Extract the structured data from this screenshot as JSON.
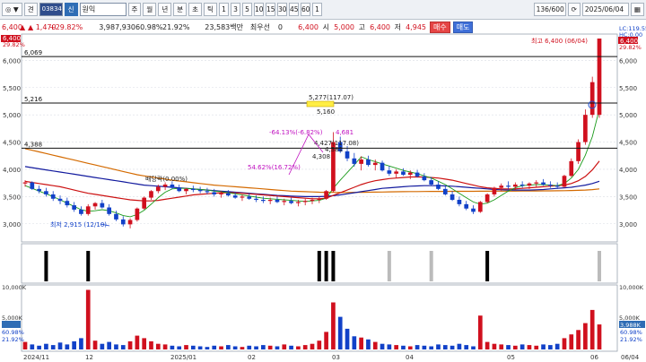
{
  "toolbar": {
    "button_a": "◎ ▼",
    "button_b": "견",
    "code_value": "038340",
    "tag": "신",
    "stock_name": "원익",
    "periods": [
      "주",
      "월",
      "년",
      "분",
      "초",
      "틱"
    ],
    "intervals": [
      "1",
      "3",
      "5",
      "10",
      "15",
      "30",
      "45",
      "60",
      "1"
    ],
    "count_value": "136/600",
    "date_value": "2025/06/04"
  },
  "quote": {
    "price": "6,400",
    "change": "▲ 1,470",
    "change_pct": "+29.82%",
    "volume": "3,987,930",
    "turnover_pct": "60.98%",
    "ratio": "21.92%",
    "amount": "23,583백만",
    "min_label": "최우선",
    "min_value": "0",
    "cur_value": "6,400",
    "open_label": "시",
    "open_value": "5,000",
    "high_label": "고",
    "high_value": "6,400",
    "low_label": "저",
    "low_value": "4,945",
    "buy_label": "매수",
    "sell_label": "매도"
  },
  "colors": {
    "up": "#d0101e",
    "down": "#1141c8",
    "ma5": "#1a9a1a",
    "ma20": "#cc1111",
    "ma60": "#121a9e",
    "ma120": "#d46a00"
  },
  "price_axis": {
    "ticks": [
      "6,000",
      "5,500",
      "5,000",
      "4,500",
      "4,000",
      "3,500",
      "3,000"
    ],
    "top_label": "6,400",
    "top_pct": "29.82%"
  },
  "right_axis": {
    "lc": "LC:119.55",
    "hc": "HC:0.00",
    "top_label": "6,400",
    "top_pct": "29.82%"
  },
  "price_lines": [
    {
      "value": 6069,
      "label": "6,069"
    },
    {
      "value": 5216,
      "label": "5,216"
    },
    {
      "value": 4388,
      "label": "4,388"
    }
  ],
  "annotations": {
    "high_text": "최고 6,400 (06/04)",
    "low_text": "최저 2,915 (12/10)",
    "dividend_text": "배당락(0.00%)",
    "box_top": "5,277(117.07)",
    "box_bottom": "5,160",
    "mid_text": "4,427(117.08)",
    "mid_low": "4,381",
    "mid_base": "4,308",
    "rise_text": "54.62%(16.72%)",
    "fall_text": "-64.13%(-6.82%)",
    "peak_text": "4,681"
  },
  "volume_axis": {
    "ticks": [
      "10,000K",
      "5,000K"
    ],
    "current": "3,988K",
    "pct": "60.98%",
    "ratio": "21.92%"
  },
  "x_axis": {
    "labels": [
      "2024/11",
      "12",
      "2025/01",
      "02",
      "03",
      "04",
      "05",
      "06",
      "06/04"
    ]
  },
  "chart_data": {
    "type": "candlestick",
    "ylim": [
      2700,
      6450
    ],
    "candles": [
      [
        3740,
        3800,
        3680,
        3760
      ],
      [
        3760,
        3780,
        3620,
        3640
      ],
      [
        3640,
        3700,
        3560,
        3600
      ],
      [
        3600,
        3660,
        3500,
        3540
      ],
      [
        3540,
        3600,
        3420,
        3460
      ],
      [
        3460,
        3520,
        3360,
        3420
      ],
      [
        3420,
        3480,
        3300,
        3340
      ],
      [
        3340,
        3400,
        3220,
        3260
      ],
      [
        3260,
        3320,
        3150,
        3180
      ],
      [
        3180,
        3360,
        3150,
        3320
      ],
      [
        3320,
        3400,
        3260,
        3380
      ],
      [
        3380,
        3440,
        3280,
        3300
      ],
      [
        3300,
        3360,
        3150,
        3180
      ],
      [
        3180,
        3240,
        3050,
        3080
      ],
      [
        3080,
        3140,
        2950,
        2990
      ],
      [
        2990,
        3100,
        2915,
        3070
      ],
      [
        3070,
        3300,
        3040,
        3280
      ],
      [
        3280,
        3500,
        3260,
        3480
      ],
      [
        3480,
        3620,
        3440,
        3600
      ],
      [
        3600,
        3720,
        3560,
        3680
      ],
      [
        3680,
        3760,
        3620,
        3720
      ],
      [
        3720,
        3780,
        3640,
        3660
      ],
      [
        3660,
        3720,
        3580,
        3600
      ],
      [
        3600,
        3660,
        3540,
        3640
      ],
      [
        3640,
        3700,
        3580,
        3620
      ],
      [
        3620,
        3680,
        3560,
        3600
      ],
      [
        3600,
        3660,
        3540,
        3580
      ],
      [
        3580,
        3640,
        3500,
        3540
      ],
      [
        3540,
        3600,
        3480,
        3560
      ],
      [
        3560,
        3620,
        3500,
        3520
      ],
      [
        3520,
        3580,
        3460,
        3480
      ],
      [
        3480,
        3540,
        3420,
        3500
      ],
      [
        3500,
        3560,
        3440,
        3460
      ],
      [
        3460,
        3520,
        3400,
        3440
      ],
      [
        3440,
        3500,
        3380,
        3420
      ],
      [
        3420,
        3480,
        3360,
        3440
      ],
      [
        3440,
        3500,
        3380,
        3400
      ],
      [
        3400,
        3460,
        3340,
        3420
      ],
      [
        3420,
        3480,
        3360,
        3380
      ],
      [
        3380,
        3440,
        3320,
        3400
      ],
      [
        3400,
        3460,
        3340,
        3420
      ],
      [
        3420,
        3480,
        3360,
        3440
      ],
      [
        3440,
        3500,
        3380,
        3460
      ],
      [
        3460,
        3620,
        3440,
        3600
      ],
      [
        3600,
        4681,
        3580,
        4500
      ],
      [
        4500,
        4600,
        4300,
        4330
      ],
      [
        4330,
        4427,
        4150,
        4200
      ],
      [
        4200,
        4300,
        4050,
        4100
      ],
      [
        4100,
        4240,
        3980,
        4180
      ],
      [
        4180,
        4250,
        4050,
        4080
      ],
      [
        4080,
        4180,
        3980,
        4120
      ],
      [
        4120,
        4160,
        3960,
        3980
      ],
      [
        3980,
        4060,
        3880,
        3920
      ],
      [
        3920,
        4000,
        3840,
        3960
      ],
      [
        3960,
        4020,
        3880,
        3900
      ],
      [
        3900,
        3980,
        3820,
        3940
      ],
      [
        3940,
        3990,
        3850,
        3870
      ],
      [
        3870,
        3930,
        3780,
        3800
      ],
      [
        3800,
        3860,
        3700,
        3720
      ],
      [
        3720,
        3780,
        3620,
        3640
      ],
      [
        3640,
        3700,
        3520,
        3540
      ],
      [
        3540,
        3600,
        3420,
        3440
      ],
      [
        3440,
        3500,
        3320,
        3360
      ],
      [
        3360,
        3420,
        3250,
        3280
      ],
      [
        3280,
        3340,
        3180,
        3220
      ],
      [
        3220,
        3420,
        3200,
        3400
      ],
      [
        3400,
        3560,
        3380,
        3540
      ],
      [
        3540,
        3680,
        3500,
        3660
      ],
      [
        3660,
        3740,
        3600,
        3700
      ],
      [
        3700,
        3780,
        3640,
        3680
      ],
      [
        3680,
        3760,
        3620,
        3720
      ],
      [
        3720,
        3780,
        3660,
        3700
      ],
      [
        3700,
        3760,
        3640,
        3740
      ],
      [
        3740,
        3800,
        3680,
        3760
      ],
      [
        3760,
        3820,
        3700,
        3720
      ],
      [
        3720,
        3780,
        3660,
        3700
      ],
      [
        3700,
        3760,
        3640,
        3680
      ],
      [
        3680,
        3900,
        3660,
        3880
      ],
      [
        3880,
        4200,
        3860,
        4150
      ],
      [
        4150,
        4550,
        4100,
        4500
      ],
      [
        4500,
        5100,
        4450,
        5000
      ],
      [
        5000,
        5700,
        4945,
        5600
      ],
      [
        5000,
        6400,
        4945,
        6400
      ]
    ],
    "ma5": [
      3700,
      3650,
      3600,
      3550,
      3500,
      3440,
      3380,
      3320,
      3260,
      3230,
      3240,
      3260,
      3240,
      3200,
      3150,
      3130,
      3170,
      3250,
      3360,
      3480,
      3580,
      3640,
      3650,
      3650,
      3640,
      3630,
      3620,
      3600,
      3590,
      3570,
      3550,
      3530,
      3510,
      3490,
      3470,
      3460,
      3450,
      3440,
      3430,
      3420,
      3410,
      3420,
      3430,
      3470,
      3650,
      3800,
      3940,
      4080,
      4230,
      4180,
      4140,
      4100,
      4060,
      4020,
      3980,
      3950,
      3920,
      3880,
      3840,
      3780,
      3720,
      3640,
      3560,
      3480,
      3400,
      3360,
      3380,
      3440,
      3520,
      3600,
      3660,
      3700,
      3710,
      3720,
      3720,
      3710,
      3700,
      3740,
      3840,
      4000,
      4260,
      4600,
      5100
    ],
    "ma20": [
      3780,
      3760,
      3740,
      3720,
      3700,
      3680,
      3650,
      3620,
      3590,
      3560,
      3540,
      3520,
      3500,
      3480,
      3460,
      3440,
      3430,
      3420,
      3420,
      3430,
      3450,
      3470,
      3490,
      3510,
      3530,
      3540,
      3550,
      3560,
      3570,
      3570,
      3570,
      3560,
      3550,
      3540,
      3530,
      3520,
      3510,
      3500,
      3490,
      3480,
      3470,
      3460,
      3460,
      3470,
      3520,
      3570,
      3620,
      3670,
      3720,
      3760,
      3790,
      3810,
      3830,
      3840,
      3850,
      3860,
      3860,
      3860,
      3850,
      3840,
      3820,
      3800,
      3770,
      3740,
      3710,
      3680,
      3660,
      3650,
      3640,
      3640,
      3640,
      3650,
      3660,
      3670,
      3680,
      3690,
      3700,
      3710,
      3740,
      3790,
      3870,
      3990,
      4150
    ],
    "ma60": [
      4050,
      4030,
      4010,
      3990,
      3970,
      3950,
      3930,
      3910,
      3890,
      3870,
      3850,
      3830,
      3810,
      3790,
      3770,
      3750,
      3730,
      3710,
      3700,
      3690,
      3680,
      3670,
      3660,
      3650,
      3640,
      3630,
      3620,
      3610,
      3600,
      3590,
      3580,
      3570,
      3560,
      3550,
      3540,
      3530,
      3520,
      3515,
      3510,
      3505,
      3500,
      3500,
      3500,
      3505,
      3515,
      3530,
      3550,
      3570,
      3590,
      3610,
      3630,
      3650,
      3660,
      3670,
      3680,
      3690,
      3695,
      3700,
      3700,
      3700,
      3695,
      3690,
      3680,
      3670,
      3660,
      3650,
      3640,
      3630,
      3625,
      3620,
      3620,
      3620,
      3620,
      3625,
      3630,
      3640,
      3650,
      3660,
      3670,
      3690,
      3710,
      3740,
      3780
    ],
    "ma120": [
      4380,
      4350,
      4320,
      4290,
      4260,
      4230,
      4200,
      4170,
      4140,
      4110,
      4080,
      4050,
      4020,
      3990,
      3960,
      3930,
      3900,
      3880,
      3860,
      3840,
      3820,
      3800,
      3785,
      3770,
      3755,
      3740,
      3725,
      3710,
      3700,
      3690,
      3680,
      3670,
      3660,
      3650,
      3640,
      3630,
      3620,
      3610,
      3600,
      3595,
      3590,
      3585,
      3580,
      3578,
      3576,
      3575,
      3575,
      3576,
      3578,
      3580,
      3582,
      3584,
      3586,
      3588,
      3590,
      3591,
      3592,
      3593,
      3594,
      3595,
      3595,
      3596,
      3596,
      3597,
      3597,
      3598,
      3598,
      3599,
      3599,
      3600,
      3600,
      3601,
      3602,
      3603,
      3604,
      3605,
      3606,
      3608,
      3611,
      3615,
      3620,
      3628,
      3640
    ],
    "volume": [
      1200,
      800,
      600,
      900,
      700,
      1100,
      800,
      1300,
      1800,
      9500,
      1400,
      900,
      1200,
      800,
      700,
      1300,
      2200,
      1800,
      1300,
      900,
      800,
      600,
      500,
      700,
      600,
      500,
      400,
      600,
      500,
      700,
      500,
      400,
      600,
      500,
      700,
      600,
      500,
      800,
      600,
      500,
      700,
      900,
      1400,
      2800,
      7500,
      5200,
      3300,
      2100,
      1900,
      1600,
      1200,
      900,
      800,
      700,
      600,
      500,
      700,
      600,
      500,
      800,
      700,
      600,
      900,
      700,
      500,
      5400,
      1200,
      900,
      800,
      700,
      600,
      800,
      700,
      600,
      800,
      700,
      900,
      1800,
      2400,
      3100,
      4200,
      6300,
      3988
    ]
  }
}
